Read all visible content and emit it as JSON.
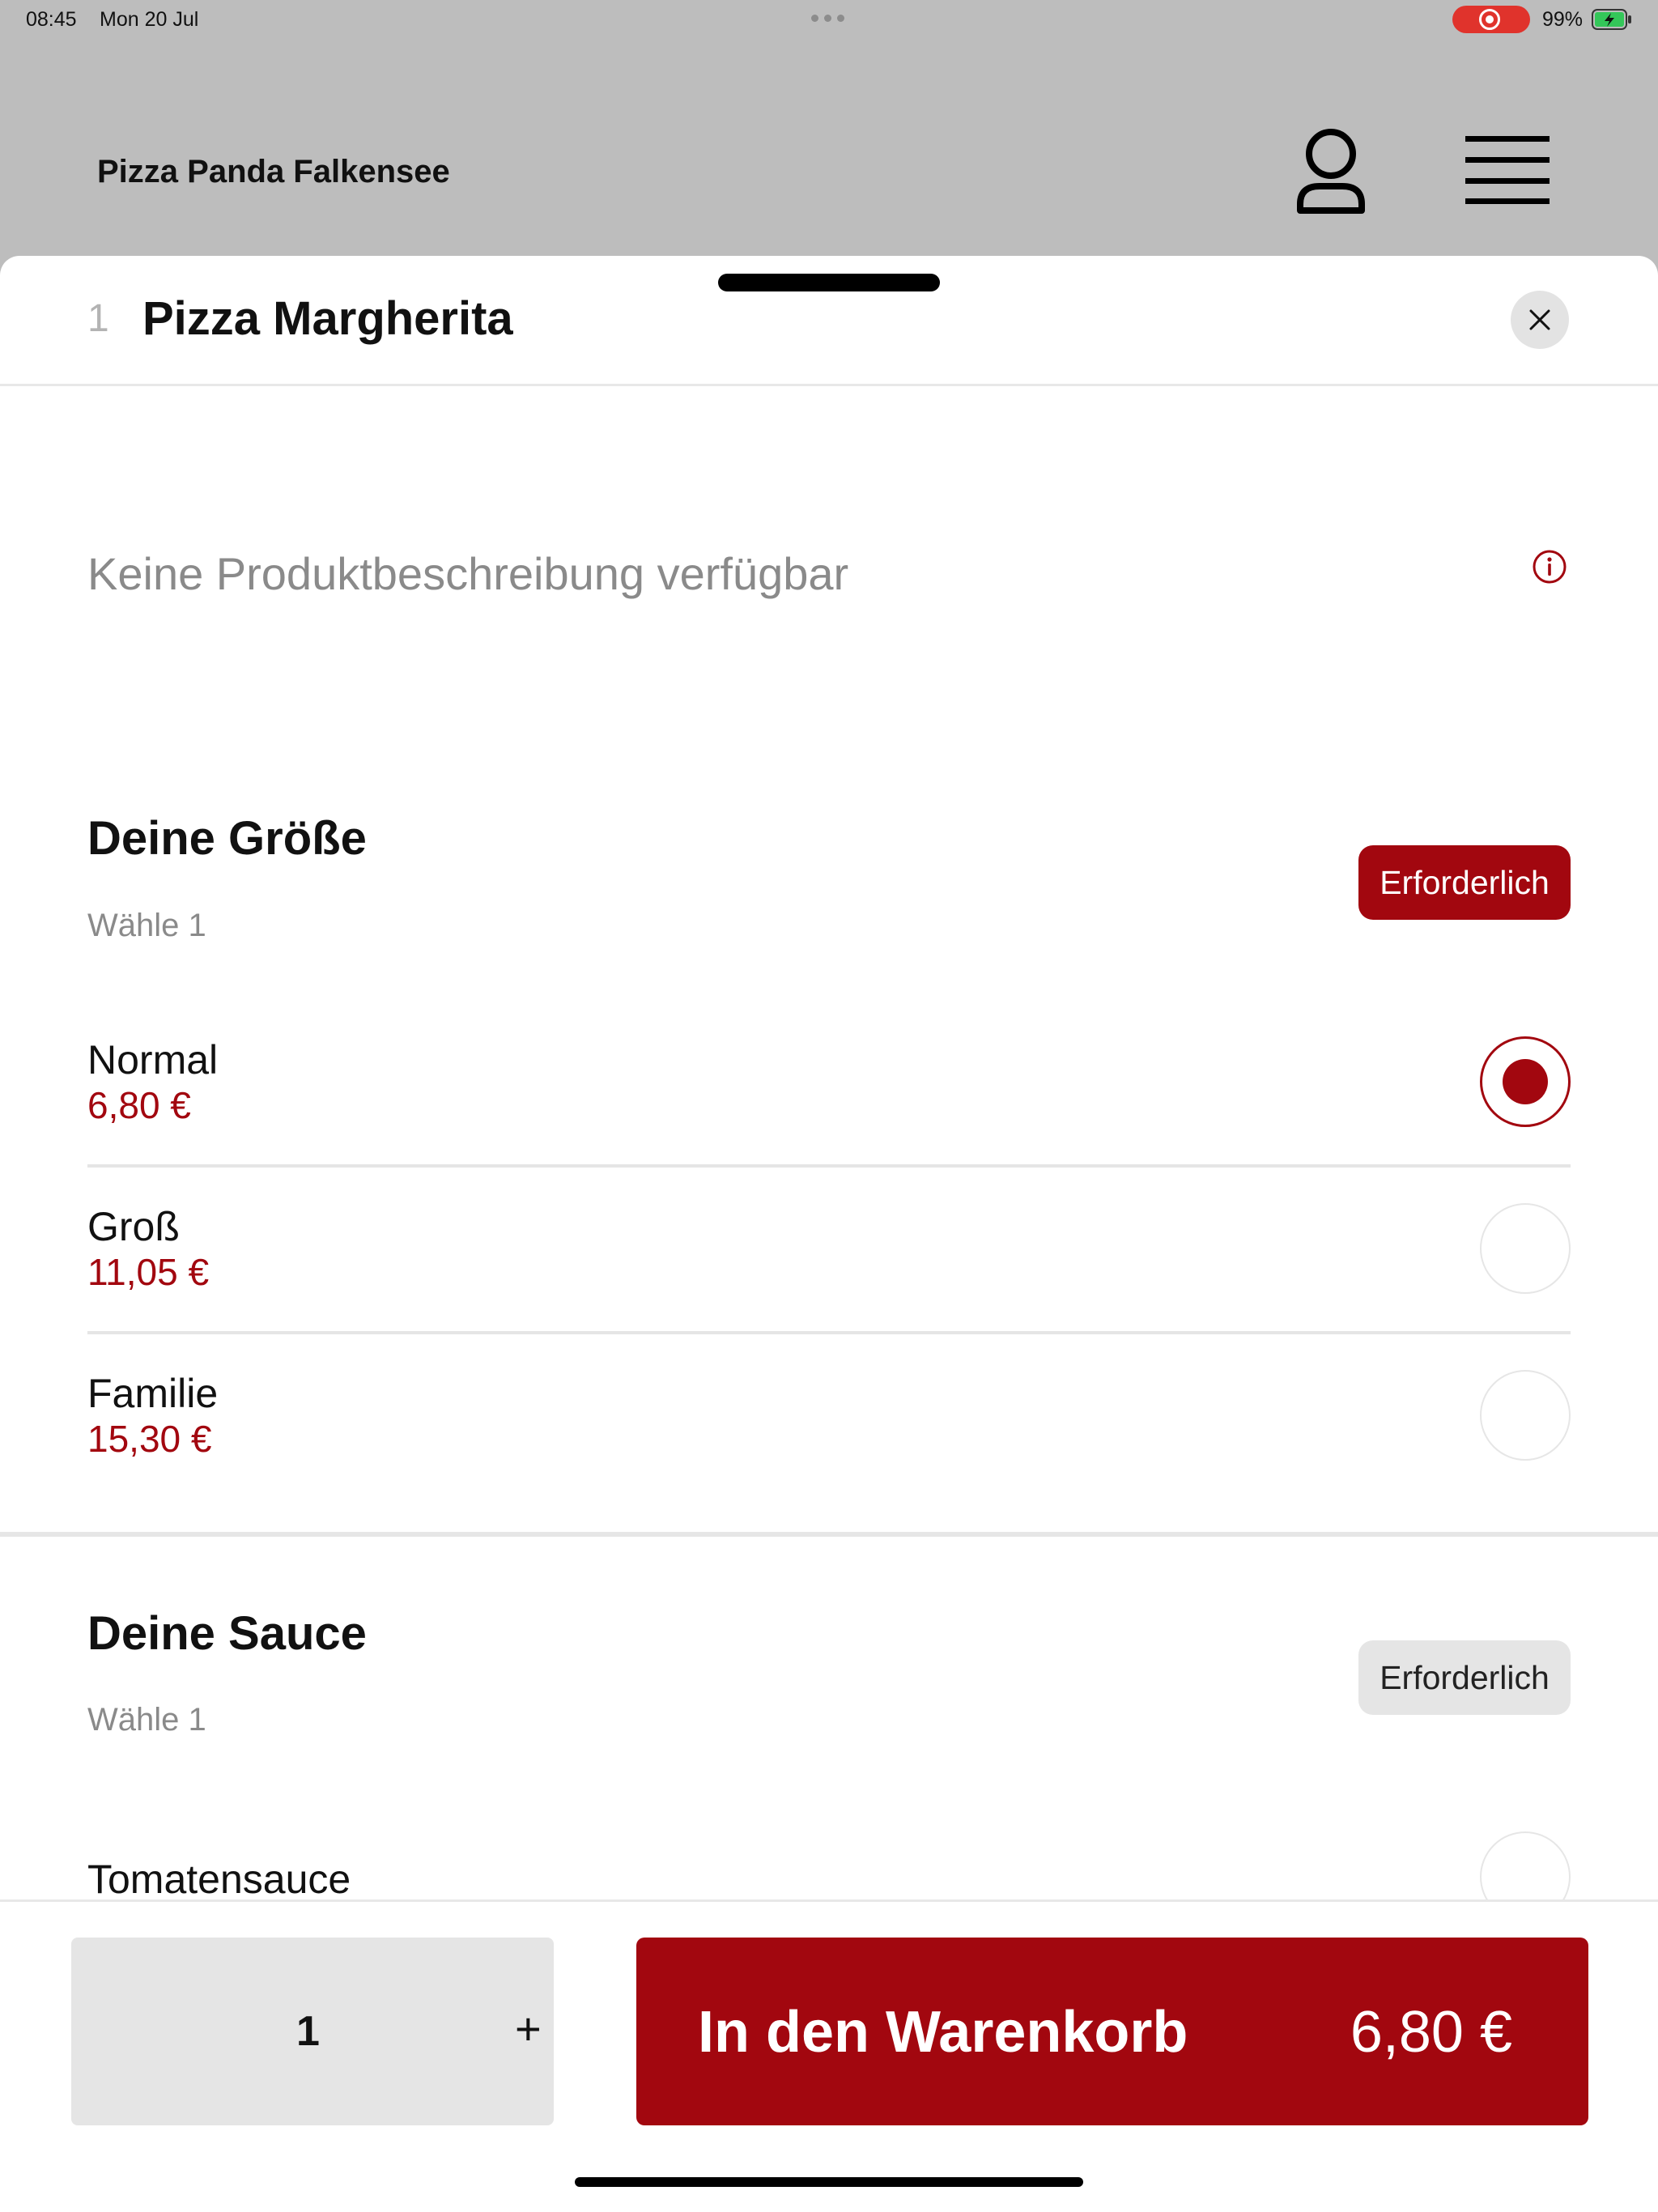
{
  "status_bar": {
    "time": "08:45",
    "date": "Mon 20 Jul",
    "battery": "99%"
  },
  "header": {
    "store_name": "Pizza Panda Falkensee"
  },
  "product": {
    "number": "1",
    "title": "Pizza Margherita",
    "description": "Keine Produktbeschreibung verfügbar"
  },
  "sections": [
    {
      "title": "Deine Größe",
      "subtitle": "Wähle 1",
      "badge": "Erforderlich",
      "options": [
        {
          "name": "Normal",
          "price": "6,80 €",
          "selected": true
        },
        {
          "name": "Groß",
          "price": "11,05 €",
          "selected": false
        },
        {
          "name": "Familie",
          "price": "15,30 €",
          "selected": false
        }
      ]
    },
    {
      "title": "Deine Sauce",
      "subtitle": "Wähle 1",
      "badge": "Erforderlich",
      "options": [
        {
          "name": "Tomatensauce",
          "selected": false
        }
      ]
    }
  ],
  "cart": {
    "quantity": "1",
    "plus": "+",
    "label": "In den Warenkorb",
    "price": "6,80 €"
  },
  "colors": {
    "accent": "#a2070f",
    "header_bg": "#bdbdbd",
    "record": "#e0332c"
  },
  "icons": [
    "record-icon",
    "battery-icon",
    "profile-icon",
    "menu-icon",
    "close-icon",
    "info-icon"
  ]
}
